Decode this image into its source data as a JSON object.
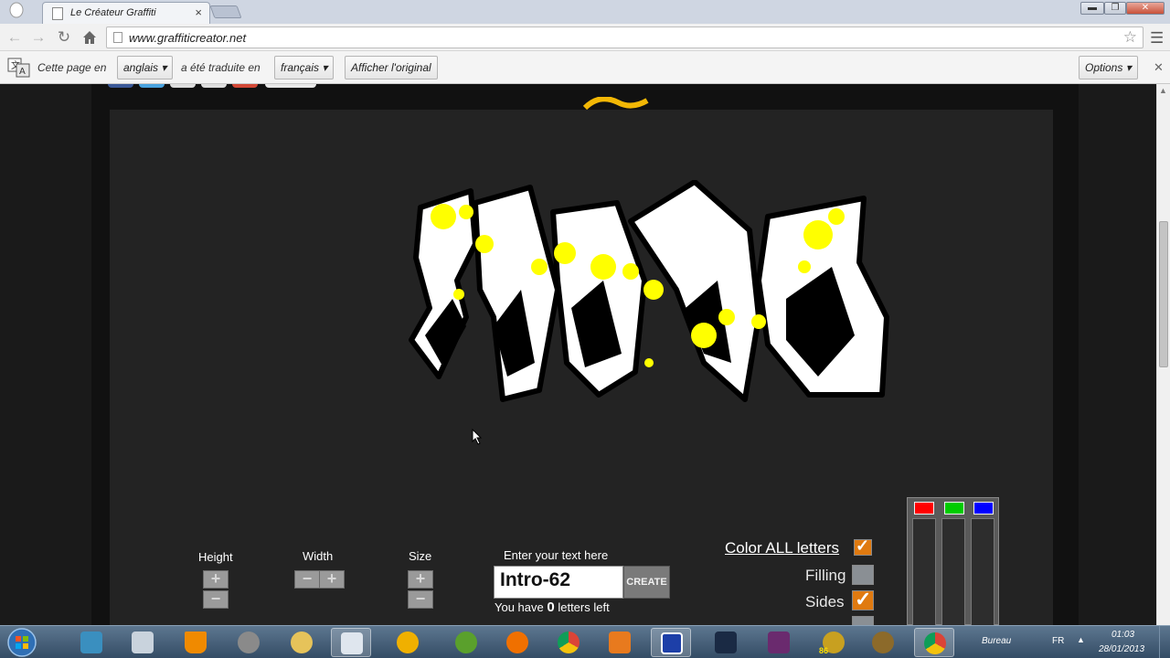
{
  "browser": {
    "tab_title": "Le Créateur Graffiti",
    "tab_close": "×",
    "url": "www.graffiticreator.net",
    "window_controls": {
      "minimize": "▬",
      "maximize": "❐",
      "close": "✕"
    }
  },
  "translate_bar": {
    "prefix": "Cette page en",
    "source_language": "anglais",
    "middle": "a été traduite en",
    "target_language": "français",
    "show_original_label": "Afficher l'original",
    "options_label": "Options",
    "close": "✕"
  },
  "graffiti": {
    "text_value": "Intro-62",
    "colors": {
      "fill": "#ffffff",
      "sides": "#000000",
      "splash": "#ffff00"
    }
  },
  "controls": {
    "height_label": "Height",
    "width_label": "Width",
    "size_label": "Size",
    "enter_text_label": "Enter your text here",
    "create_button": "CREATE",
    "letters_left_prefix": "You have",
    "letters_left_count": "0",
    "letters_left_suffix": "letters left",
    "color_all_label": "Color ALL letters",
    "filling_label": "Filling",
    "sides_label": "Sides",
    "plus": "+",
    "minus": "−"
  },
  "color_panel": {
    "swatches": [
      "#ff0000",
      "#00cc00",
      "#0000ff"
    ]
  },
  "taskbar": {
    "bureau_label": "Bureau",
    "language": "FR",
    "time": "01:03",
    "date": "28/01/2013",
    "badge": "86"
  }
}
